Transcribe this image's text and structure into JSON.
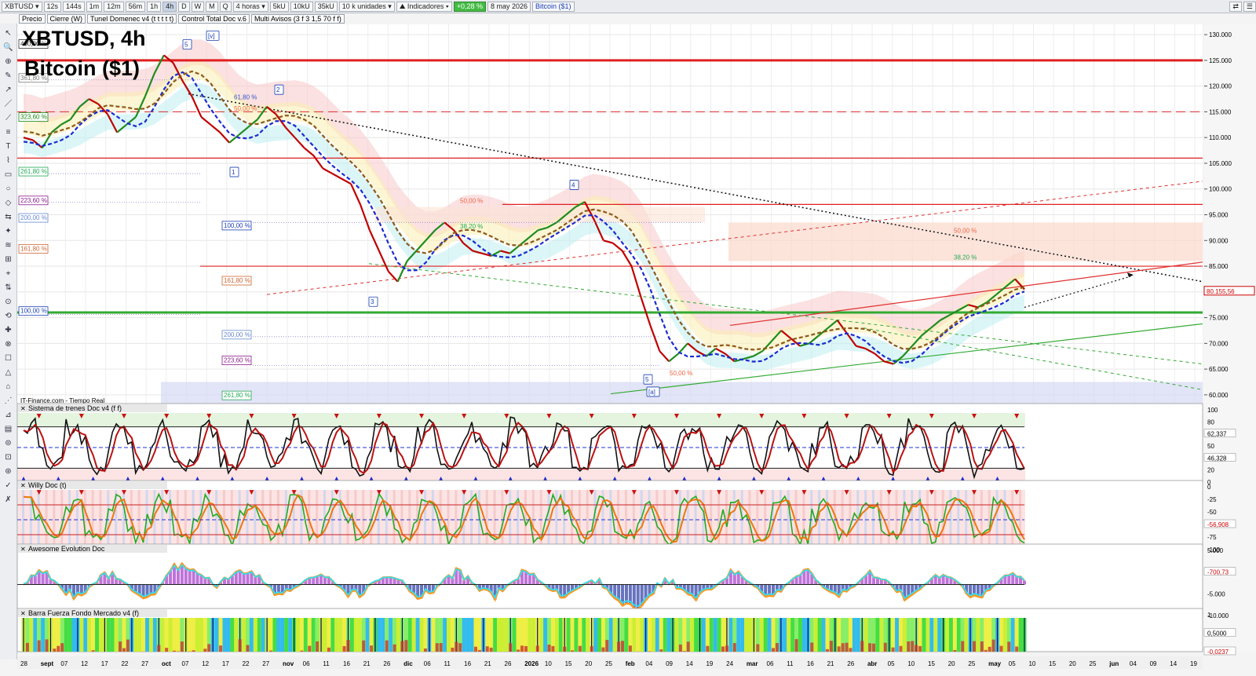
{
  "toolbar": {
    "symbol": "XBTUSD",
    "intervals": [
      "12s",
      "144s",
      "1m",
      "12m",
      "56m",
      "1h",
      "4h",
      "D",
      "W",
      "M",
      "Q"
    ],
    "active_interval": "4h",
    "period": "4 horas",
    "units": [
      "5kU",
      "10kU",
      "35kU"
    ],
    "units_count": "10 k unidades",
    "indicators": "Indicadores",
    "change": "+0,28 %",
    "date": "8 may 2026",
    "name": "Bitcoin ($1)"
  },
  "subbar": {
    "items": [
      "Precio",
      "Cierre (W)",
      "Tunel Domenec v4 (t t t t t)",
      "Control Total Doc v.6",
      "Multi Avisos (3 f 3 1,5 70 f f)"
    ]
  },
  "chart_title": {
    "line1": "XBTUSD, 4h",
    "line2": "Bitcoin ($1)"
  },
  "source_label": "IT-Finance.com - Tiempo Real",
  "panels": [
    {
      "title": "Sistema de trenes Doc v4 (f f)",
      "axis": [
        "100",
        "80",
        "62,337",
        "50",
        "46,328",
        "20",
        "0"
      ]
    },
    {
      "title": "Willy Doc (t)",
      "axis": [
        "0",
        "-25",
        "-50",
        "-56,908",
        "-75",
        "-100"
      ]
    },
    {
      "title": "Awesome Evolution Doc",
      "axis": [
        "5.000",
        "-700,73",
        "-5.000",
        "-10.000"
      ]
    },
    {
      "title": "Barra Fuerza Fondo Mercado v4 (f)",
      "axis": [
        "1",
        "0,5000",
        "-0,0237"
      ]
    }
  ],
  "chart_data": {
    "type": "line",
    "title": "XBTUSD, 4h",
    "subtitle": "Bitcoin ($1)",
    "y_ticks": [
      60000,
      65000,
      70000,
      75000,
      80000,
      85000,
      90000,
      95000,
      100000,
      105000,
      110000,
      115000,
      120000,
      125000,
      130000
    ],
    "y_tick_labels": [
      "60.000",
      "65.000",
      "70.000",
      "75.000",
      "80.000",
      "85.000",
      "90.000",
      "95.000",
      "100.000",
      "105.000",
      "110.000",
      "115.000",
      "120.000",
      "125.000",
      "130.000"
    ],
    "ylim": [
      58000,
      132000
    ],
    "last_price_labels": [
      "80.155,56"
    ],
    "x_tick_labels": [
      "28",
      "sept",
      "07",
      "12",
      "17",
      "22",
      "27",
      "oct",
      "07",
      "12",
      "17",
      "22",
      "27",
      "nov",
      "06",
      "11",
      "16",
      "21",
      "26",
      "dic",
      "06",
      "11",
      "16",
      "21",
      "26",
      "2026",
      "10",
      "15",
      "20",
      "25",
      "feb",
      "04",
      "09",
      "14",
      "19",
      "24",
      "mar",
      "06",
      "11",
      "16",
      "21",
      "26",
      "abr",
      "05",
      "10",
      "15",
      "20",
      "25",
      "may",
      "05",
      "10",
      "15",
      "20",
      "25",
      "jun",
      "04",
      "09",
      "14",
      "19"
    ],
    "wave_labels": [
      "[v]",
      "5",
      "2",
      "1",
      "3",
      "4",
      "5",
      "[a]"
    ],
    "fib_labels": [
      "400,00 %",
      "361,80 %",
      "323,60 %",
      "261,80 %",
      "223,60 %",
      "200,00 %",
      "161,80 %",
      "100,00 %",
      "61,80 %",
      "50,00 %",
      "100,00 %",
      "161,80 %",
      "200,00 %",
      "223,60 %",
      "261,80 %",
      "50,00 %",
      "38,20 %",
      "50,00 %",
      "38,20 %",
      "50,00 %"
    ],
    "series": [
      {
        "values": [
          110000,
          109500,
          108000,
          111000,
          112500,
          113500,
          116000,
          117500,
          116500,
          114500,
          111000,
          112500,
          114000,
          118000,
          122500,
          126000,
          124500,
          121000,
          118000,
          114000,
          112500,
          111000,
          109000,
          110500,
          112000,
          113500,
          116000,
          114500,
          112000,
          110000,
          108000,
          106500,
          104000,
          103000,
          102000,
          101000,
          97000,
          92000,
          88000,
          84000,
          82000,
          86000,
          88000,
          90000,
          92000,
          93500,
          92000,
          89500,
          88000,
          87500,
          87000,
          88000,
          87500,
          89000,
          90500,
          92000,
          92500,
          93500,
          95000,
          96500,
          97500,
          94000,
          90000,
          89500,
          88000,
          85000,
          79000,
          73500,
          68500,
          66500,
          68000,
          70000,
          68500,
          67500,
          69000,
          68000,
          66500,
          67000,
          67500,
          68500,
          70500,
          72500,
          71000,
          69500,
          70000,
          71500,
          73000,
          74500,
          72000,
          69500,
          69000,
          68000,
          66500,
          66000,
          67500,
          69500,
          71500,
          73000,
          74500,
          75500,
          76500,
          77500,
          77000,
          78000,
          79500,
          81000,
          82500,
          80500
        ]
      }
    ],
    "horizontal_levels": [
      {
        "value": 125000,
        "color": "#e02020",
        "style": "solid"
      },
      {
        "value": 115000,
        "color": "#e04040",
        "style": "dashed"
      },
      {
        "value": 106000,
        "color": "#e02020",
        "style": "solid"
      },
      {
        "value": 97000,
        "color": "#e02020",
        "style": "solid"
      },
      {
        "value": 85000,
        "color": "#e02020",
        "style": "solid"
      },
      {
        "value": 76000,
        "color": "#33aa33",
        "style": "solid"
      }
    ],
    "colors": {
      "bull": "#1e8c1e",
      "bear": "#c00000",
      "accent_blue": "#1b2bd1",
      "accent_brown": "#8b5a1a",
      "level_red": "#e02020",
      "level_green": "#33aa33"
    }
  }
}
